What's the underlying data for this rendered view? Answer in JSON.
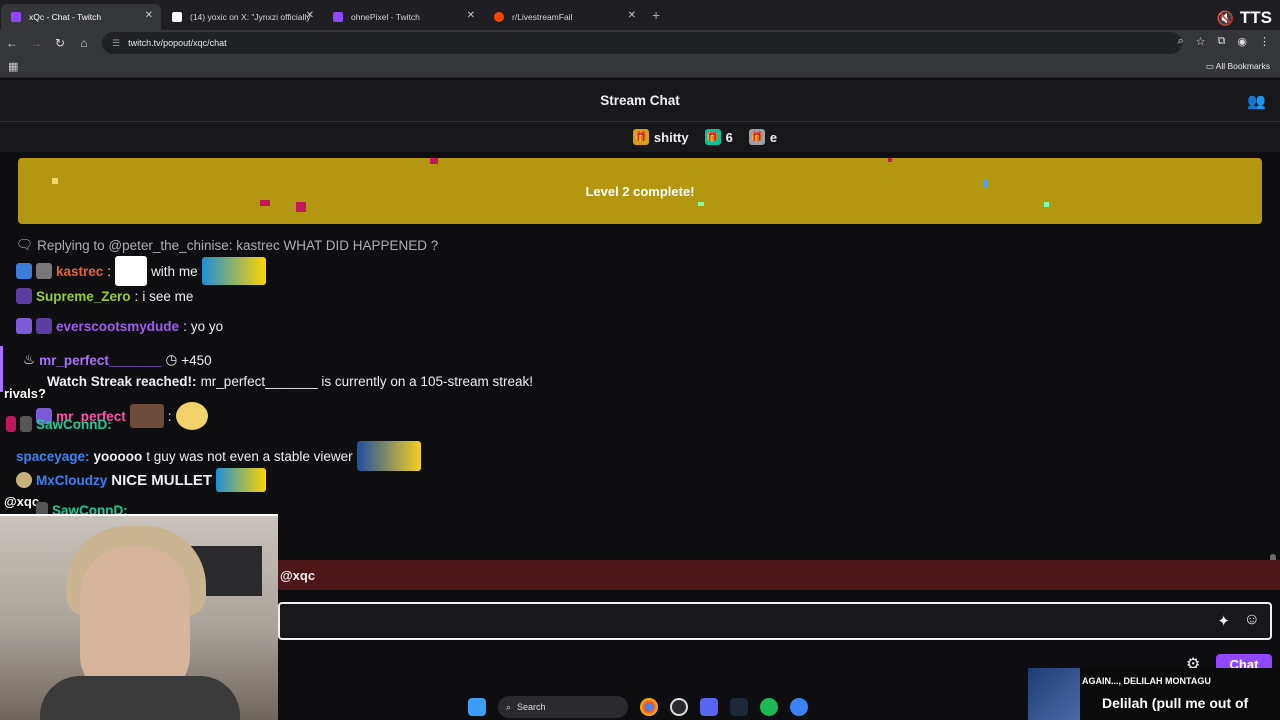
{
  "browser": {
    "tabs": [
      {
        "title": "xQc - Chat - Twitch",
        "favicon_color": "#9147ff",
        "active": true
      },
      {
        "title": "(14) yoxic on X: \"Jynxzi officially",
        "favicon_color": "#ffffff",
        "active": false
      },
      {
        "title": "ohnePixel - Twitch",
        "favicon_color": "#9147ff",
        "active": false
      },
      {
        "title": "r/LivestreamFail",
        "favicon_color": "#ff4500",
        "active": false
      }
    ],
    "new_tab": "+",
    "url": "twitch.tv/popout/xqc/chat",
    "bookmarks_label": "All Bookmarks",
    "tts_label": "TTS"
  },
  "chat": {
    "header_title": "Stream Chat",
    "gift_bar": [
      {
        "icon": "gift-icon",
        "label": "shitty",
        "color": "#d4a017"
      },
      {
        "icon": "gift-icon",
        "label": "6",
        "color": "#00c6a0"
      },
      {
        "icon": "gift-icon",
        "label": "e",
        "color": "#9aa0a6"
      }
    ],
    "level_banner": "Level 2 complete!",
    "reply_line": "Replying to @peter_the_chinise: kastrec WHAT DID HAPPENED ?",
    "messages": [
      {
        "user": "kastrec",
        "color": "#e0652f",
        "text": "with me"
      },
      {
        "user": "Supreme_Zero",
        "color": "#9acd32",
        "text": "i see me"
      },
      {
        "user": "everscootsmydude",
        "color": "#a25cf0",
        "text": "yo yo"
      }
    ],
    "streak": {
      "user": "mr_perfect_______",
      "points": "+450",
      "title": "Watch Streak reached!:",
      "text": "mr_perfect_______ is currently on a 105-stream streak!"
    },
    "overlay_lines": [
      {
        "user": "mr_perfect",
        "color": "#ff4fa8"
      },
      {
        "user": "SawConnD:",
        "color": "#20c997"
      },
      {
        "user": "spaceyage:",
        "color": "#3b82f6",
        "text": "yooooo",
        "extra": "t guy was not even a stable viewer"
      },
      {
        "user": "MxCloudzy",
        "color": "#3b82f6",
        "text": "NICE MULLET"
      },
      {
        "user": "SawConnD:",
        "color": "#20c997"
      }
    ],
    "overlay_snippets": {
      "rivals": "rivals?",
      "mention": "@xqc"
    },
    "mention_bar": "@xqc",
    "chat_button": "Chat"
  },
  "taskbar": {
    "search_label": "Search"
  },
  "now_playing": {
    "line1": "AGAIN..., DELILAH MONTAGU",
    "line2": "Delilah (pull me out of"
  }
}
